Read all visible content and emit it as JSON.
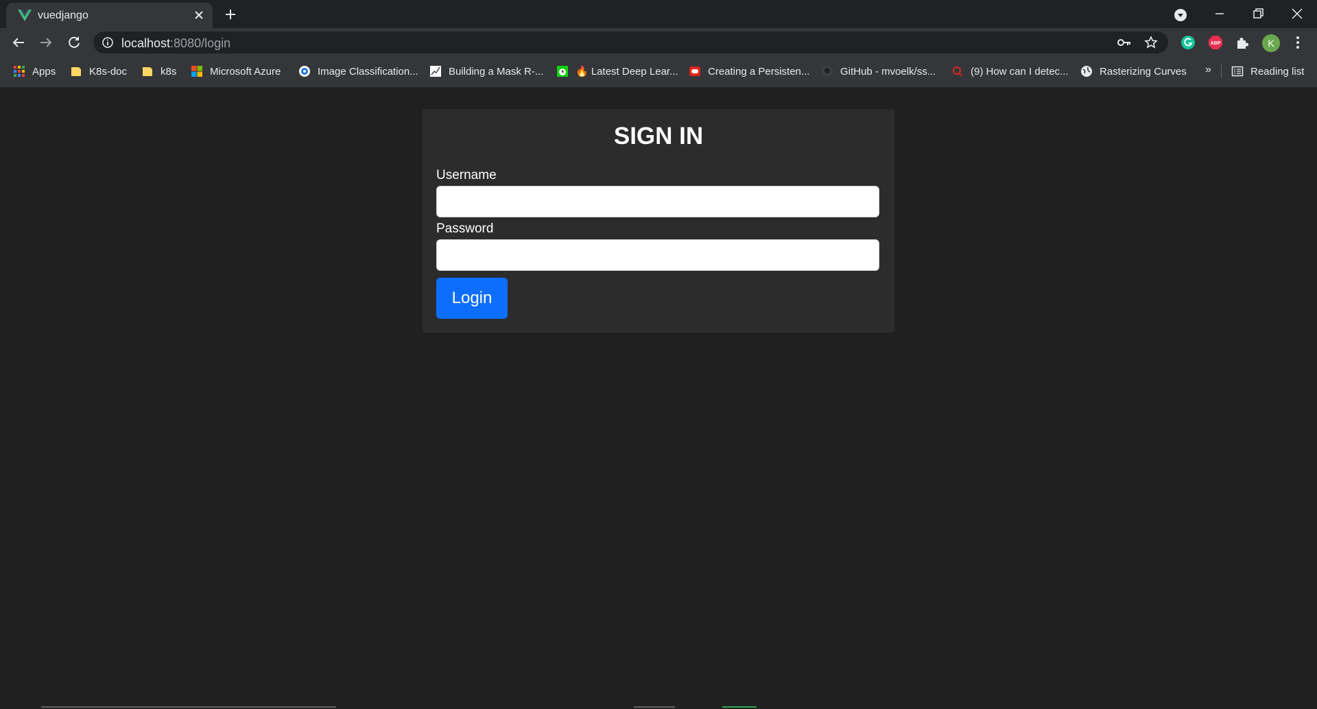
{
  "browser": {
    "tab": {
      "title": "vuedjango",
      "favicon_color": "#41b883"
    },
    "address": {
      "host": "localhost",
      "rest": ":8080/login"
    },
    "profile_initial": "K",
    "bookmarks": [
      {
        "label": "Apps",
        "icon": "apps-grid-icon"
      },
      {
        "label": "K8s-doc",
        "icon": "folder-icon"
      },
      {
        "label": "k8s",
        "icon": "folder-icon"
      },
      {
        "label": "Microsoft Azure",
        "icon": "microsoft-logo-icon"
      },
      {
        "label": "Image Classification...",
        "icon": "target-icon"
      },
      {
        "label": "Building a Mask R-...",
        "icon": "chart-page-icon"
      },
      {
        "label": "🔥 Latest Deep Lear...",
        "icon": "green-clock-icon"
      },
      {
        "label": "Creating a Persisten...",
        "icon": "oracle-icon"
      },
      {
        "label": "GitHub - mvoelk/ss...",
        "icon": "github-icon"
      },
      {
        "label": "(9) How can I detec...",
        "icon": "quora-icon"
      },
      {
        "label": "Rasterizing Curves",
        "icon": "globe-icon"
      }
    ],
    "more_label": "»",
    "reading_list_label": "Reading list"
  },
  "login_form": {
    "title": "SIGN IN",
    "username_label": "Username",
    "username_value": "",
    "password_label": "Password",
    "password_value": "",
    "submit_label": "Login"
  },
  "colors": {
    "page_background": "#202020",
    "card_background": "#2c2c2c",
    "primary_button": "#0d6efd"
  }
}
